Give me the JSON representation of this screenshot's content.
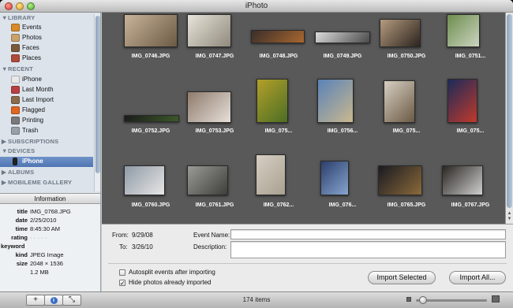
{
  "window": {
    "title": "iPhoto"
  },
  "sidebar": {
    "library_header": "LIBRARY",
    "library": [
      {
        "label": "Events",
        "icon": "events-icon",
        "color": "#d98a2a"
      },
      {
        "label": "Photos",
        "icon": "photos-icon",
        "color": "#c9a26a"
      },
      {
        "label": "Faces",
        "icon": "faces-icon",
        "color": "#7a5a3a"
      },
      {
        "label": "Places",
        "icon": "places-icon",
        "color": "#b04a3a"
      }
    ],
    "recent_header": "RECENT",
    "recent": [
      {
        "label": "iPhone",
        "icon": "iphone-event-icon",
        "color": "#e8e8e8"
      },
      {
        "label": "Last Month",
        "icon": "calendar-icon",
        "color": "#b94040"
      },
      {
        "label": "Last Import",
        "icon": "last-import-icon",
        "color": "#8b6b4b"
      },
      {
        "label": "Flagged",
        "icon": "flag-icon",
        "color": "#e0651e"
      },
      {
        "label": "Printing",
        "icon": "printing-icon",
        "color": "#7a7a7a"
      },
      {
        "label": "Trash",
        "icon": "trash-icon",
        "color": "#9aa0a6"
      }
    ],
    "subscriptions_header": "SUBSCRIPTIONS",
    "devices_header": "DEVICES",
    "devices": [
      {
        "label": "iPhone",
        "icon": "iphone-device-icon",
        "color": "#222222"
      }
    ],
    "albums_header": "ALBUMS",
    "mobileme_header": "MOBILEME GALLERY"
  },
  "info": {
    "header": "Information",
    "rows": [
      {
        "key": "title",
        "value": "IMG_0768.JPG"
      },
      {
        "key": "date",
        "value": "2/25/2010"
      },
      {
        "key": "time",
        "value": "8:45:30 AM"
      },
      {
        "key": "rating",
        "value": "· · · · ·"
      }
    ],
    "keyword_label": "keyword",
    "rows2": [
      {
        "key": "kind",
        "value": "JPEG Image"
      },
      {
        "key": "size",
        "value": "2048 × 1536"
      },
      {
        "key": "",
        "value": "1.2 MB"
      }
    ]
  },
  "photos": [
    {
      "name": "IMG_0746.JPG",
      "c1": "#c9b49a",
      "c2": "#6b5a44"
    },
    {
      "name": "IMG_0747.JPG",
      "c1": "#e8e4da",
      "c2": "#8f8a7c"
    },
    {
      "name": "IMG_0748.JPG",
      "c1": "#3a2e2a",
      "c2": "#a8672f"
    },
    {
      "name": "IMG_0749.JPG",
      "c1": "#dcdcdc",
      "c2": "#4a4a4a"
    },
    {
      "name": "IMG_0750.JPG",
      "c1": "#b59b7e",
      "c2": "#2c241e"
    },
    {
      "name": "IMG_0751...",
      "c1": "#6d8d4e",
      "c2": "#cbd4c0"
    },
    {
      "name": "IMG_0752.JPG",
      "c1": "#1a1a1a",
      "c2": "#3d5a2a"
    },
    {
      "name": "IMG_0753.JPG",
      "c1": "#8f7b6b",
      "c2": "#e6e0da"
    },
    {
      "name": "IMG_075...",
      "c1": "#b3a02a",
      "c2": "#4c6e24"
    },
    {
      "name": "IMG_0756...",
      "c1": "#5a82b8",
      "c2": "#c9b88e"
    },
    {
      "name": "IMG_075...",
      "c1": "#d7cfc2",
      "c2": "#6b5a44"
    },
    {
      "name": "IMG_075...",
      "c1": "#1b2b5a",
      "c2": "#c0392b"
    },
    {
      "name": "IMG_0760.JPG",
      "c1": "#8f9aa6",
      "c2": "#e6e6e6"
    },
    {
      "name": "IMG_0761.JPG",
      "c1": "#9a9a96",
      "c2": "#3e3e3a"
    },
    {
      "name": "IMG_0762...",
      "c1": "#d6cfc2",
      "c2": "#a9a090"
    },
    {
      "name": "IMG_076...",
      "c1": "#2b3f6b",
      "c2": "#88a4d0"
    },
    {
      "name": "IMG_0765.JPG",
      "c1": "#1a1a22",
      "c2": "#8a6a3a"
    },
    {
      "name": "IMG_0767.JPG",
      "c1": "#2a2622",
      "c2": "#cfcfcf"
    }
  ],
  "import": {
    "from_label": "From:",
    "from_value": "9/29/08",
    "to_label": "To:",
    "to_value": "3/26/10",
    "event_name_label": "Event Name:",
    "event_name_value": "",
    "description_label": "Description:",
    "description_value": "",
    "autosplit_label": "Autosplit events after importing",
    "autosplit_checked": false,
    "hide_label": "Hide photos already imported",
    "hide_checked": true,
    "import_selected": "Import Selected",
    "import_all": "Import All..."
  },
  "bottom": {
    "add": "+",
    "info": "i",
    "fullscreen": "⤡",
    "item_count": "174 items",
    "zoom_level": 0.05
  }
}
